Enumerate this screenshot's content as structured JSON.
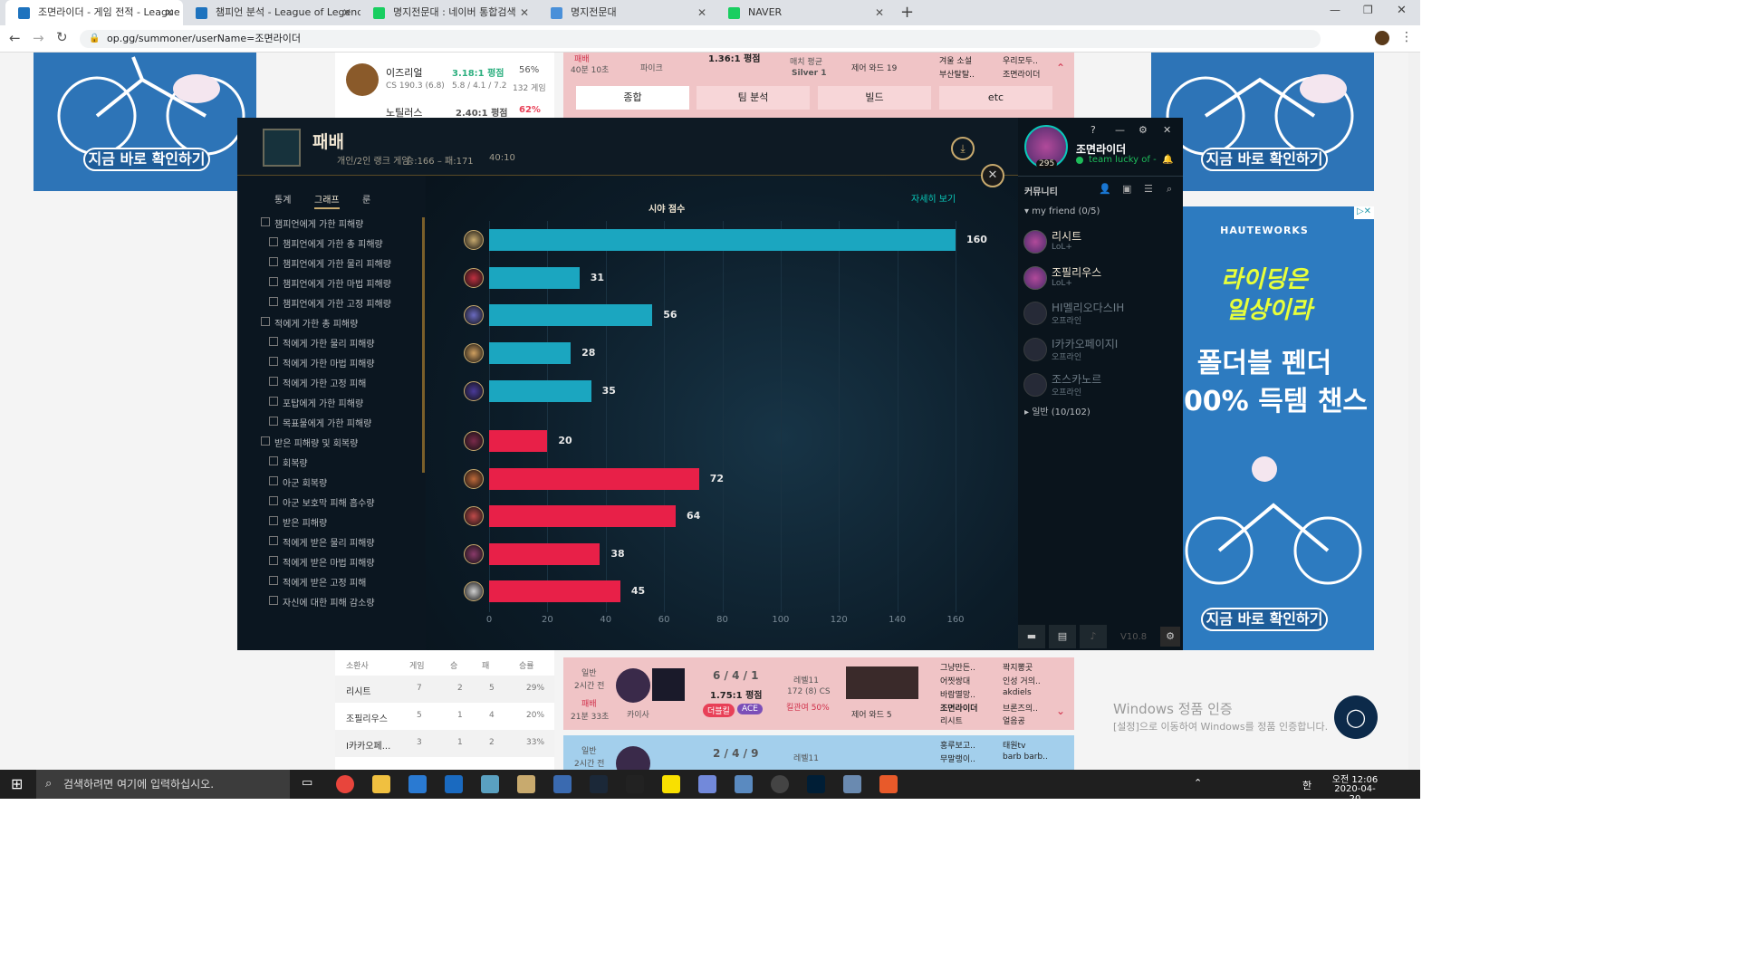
{
  "browser": {
    "tabs": [
      {
        "title": "조면라이더 - 게임 전적 - League",
        "color": "#1e73be"
      },
      {
        "title": "챔피언 분석 - League of Legends",
        "color": "#1e73be"
      },
      {
        "title": "명지전문대 : 네이버 통합검색",
        "color": "#19ce60"
      },
      {
        "title": "명지전문대",
        "color": "#4a90d9"
      },
      {
        "title": "NAVER",
        "color": "#19ce60"
      }
    ],
    "url": "op.gg/summoner/userName=조면라이더"
  },
  "ads": {
    "left_btn": "지금 바로 확인하기",
    "right_btn": "지금 바로 확인하기",
    "brand": "HAUTEWORKS",
    "line1": "라이딩은",
    "line2": "일상이라",
    "line3": "폴더블 펜더",
    "line4": "00% 득템 챈스",
    "right_bottom_btn": "지금 바로 확인하기"
  },
  "opgg_top": {
    "rows": [
      {
        "name": "이즈리얼",
        "kda": "3.18:1 평점",
        "wr": "56%",
        "sub": "CS 190.3 (6.8)",
        "kda2": "5.8 / 4.1 / 7.2",
        "games": "132 게임"
      },
      {
        "name": "노틸러스",
        "kda": "2.40:1 평점",
        "wr": "62%"
      }
    ],
    "match": {
      "result": "패배",
      "time": "40분 10초",
      "champ": "파이크",
      "kda": "1.36:1 평점",
      "avg": "매치 평균",
      "tier": "Silver 1",
      "ward": "제어 와드 19",
      "p1": "겨울 소설",
      "p2": "부산탈탈..",
      "p3": "우리모두..",
      "p4": "조면라이더"
    },
    "tabs": [
      "종합",
      "팀 분석",
      "빌드",
      "etc"
    ]
  },
  "client": {
    "result": "패배",
    "queue": "개인/2인 랭크 게임",
    "record": "승:166 – 패:171",
    "duration": "40:10",
    "tabs": [
      "통계",
      "그래프",
      "룬"
    ],
    "more": "자세히 보기",
    "stats": [
      "챔피언에게 가한 피해량",
      "챔피언에게 가한 총 피해량",
      "챔피언에게 가한 물리 피해량",
      "챔피언에게 가한 마법 피해량",
      "챔피언에게 가한 고정 피해량",
      "적에게 가한 총 피해량",
      "적에게 가한 물리 피해량",
      "적에게 가한 마법 피해량",
      "적에게 가한 고정 피해",
      "포탑에게 가한 피해량",
      "목표물에게 가한 피해량",
      "받은 피해량 및 회복량",
      "회복량",
      "아군 회복량",
      "아군 보호막 피해 흡수량",
      "받은 피해량",
      "적에게 받은 물리 피해량",
      "적에게 받은 마법 피해량",
      "적에게 받은 고정 피해",
      "자신에 대한 피해 감소량"
    ]
  },
  "chart_data": {
    "type": "bar",
    "title": "시야 점수",
    "categories": [
      "p1",
      "p2",
      "p3",
      "p4",
      "p5",
      "p6",
      "p7",
      "p8",
      "p9",
      "p10"
    ],
    "values": [
      160,
      31,
      56,
      28,
      35,
      20,
      72,
      64,
      38,
      45
    ],
    "teams": [
      "blue",
      "blue",
      "blue",
      "blue",
      "blue",
      "red",
      "red",
      "red",
      "red",
      "red"
    ],
    "xlim": [
      0,
      160
    ],
    "xticks": [
      "0",
      "20",
      "40",
      "60",
      "80",
      "100",
      "120",
      "140",
      "160"
    ],
    "colors": {
      "blue": "#1ba6c0",
      "red": "#e82048"
    }
  },
  "social": {
    "name": "조면라이더",
    "level": "295",
    "status": "team lucky of -",
    "community": "커뮤니티",
    "group1": "my friend (0/5)",
    "group2": "일반 (10/102)",
    "friends": [
      {
        "name": "리시트",
        "status": "LoL+"
      },
      {
        "name": "조필리우스",
        "status": "LoL+"
      },
      {
        "name": "HI멜리오다스IH",
        "status": "오프라인"
      },
      {
        "name": "I카카오페이지I",
        "status": "오프라인"
      },
      {
        "name": "조스카노르",
        "status": "오프라인"
      }
    ],
    "version": "V10.8"
  },
  "opgg_bottom": {
    "headers": [
      "소환사",
      "게임",
      "승",
      "패",
      "승률"
    ],
    "rows": [
      [
        "리시트",
        "7",
        "2",
        "5",
        "29%"
      ],
      [
        "조필리우스",
        "5",
        "1",
        "4",
        "20%"
      ],
      [
        "I카카오페...",
        "3",
        "1",
        "2",
        "33%"
      ]
    ],
    "match": {
      "type": "일반",
      "ago": "2시간 전",
      "result": "패배",
      "time": "21분 33초",
      "champ": "카이사",
      "kda": "6 / 4 / 1",
      "ratio": "1.75:1 평점",
      "badge1": "더블킬",
      "badge2": "ACE",
      "level": "레벨11",
      "cs": "172 (8) CS",
      "kp": "킬관여 50%",
      "ward": "제어 와드 5",
      "p1": "그냥만든..",
      "p2": "어찟쌍대",
      "p3": "바람멸망..",
      "p4": "조면라이더",
      "p5": "리시트",
      "q1": "꽉지뽕곳",
      "q2": "인성 거의..",
      "q3": "akdiels",
      "q4": "브론즈의..",
      "q5": "얼음공"
    },
    "match2": {
      "type": "일반",
      "ago": "2시간 전",
      "kda": "2 / 4 / 9",
      "level": "레벨11",
      "p1": "홍루보고..",
      "p2": "무말랭이..",
      "q1": "태원tv",
      "q2": "barb barb.."
    }
  },
  "windows": {
    "activate": "Windows 정품 인증",
    "activate_sub": "[설정]으로 이동하여 Windows를 정품 인증합니다.",
    "search": "검색하려면 여기에 입력하십시오.",
    "time": "오전 12:06",
    "date": "2020-04-20"
  }
}
